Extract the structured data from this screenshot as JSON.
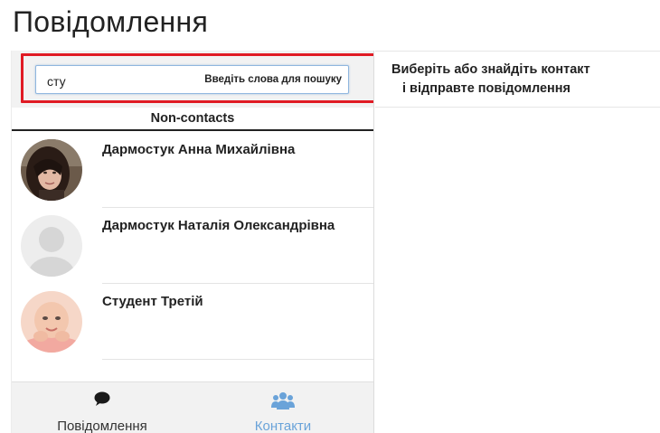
{
  "page": {
    "title": "Повідомлення"
  },
  "search": {
    "value": "сту",
    "hint": "Введіть слова для пошуку",
    "highlight_color": "#e01b24"
  },
  "contacts_section": {
    "header": "Non-contacts",
    "items": [
      {
        "name": "Дармостук Анна Михайлівна",
        "avatar": "photo-avatar-woman"
      },
      {
        "name": "Дармостук Наталія Олександрівна",
        "avatar": "default-user-avatar"
      },
      {
        "name": "Студент Третій",
        "avatar": "photo-avatar-baby"
      }
    ]
  },
  "bottom_nav": {
    "items": [
      {
        "label": "Повідомлення",
        "icon": "speech-bubble-icon",
        "active": false
      },
      {
        "label": "Контакти",
        "icon": "users-icon",
        "active": true
      }
    ],
    "active_color": "#6aa3d9"
  },
  "right_panel": {
    "prompt_line1": "Виберіть або знайдіть контакт",
    "prompt_line2": "і відправте повідомлення"
  }
}
